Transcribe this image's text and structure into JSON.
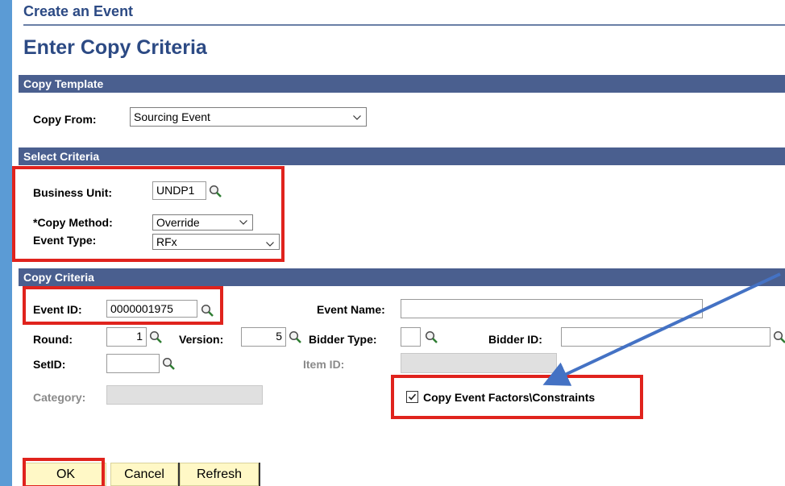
{
  "header": {
    "breadcrumb": "Create an Event",
    "title": "Enter Copy Criteria"
  },
  "copy_template": {
    "section_label": "Copy Template",
    "copy_from_label": "Copy From:",
    "copy_from_value": "Sourcing Event"
  },
  "select_criteria": {
    "section_label": "Select Criteria",
    "business_unit_label": "Business Unit:",
    "business_unit_value": "UNDP1",
    "copy_method_label": "*Copy Method:",
    "copy_method_value": "Override",
    "event_type_label": "Event Type:",
    "event_type_value": "RFx"
  },
  "copy_criteria": {
    "section_label": "Copy Criteria",
    "event_id_label": "Event ID:",
    "event_id_value": "0000001975",
    "event_name_label": "Event Name:",
    "event_name_value": "",
    "round_label": "Round:",
    "round_value": "1",
    "version_label": "Version:",
    "version_value": "5",
    "bidder_type_label": "Bidder Type:",
    "bidder_type_value": "",
    "bidder_id_label": "Bidder ID:",
    "bidder_id_value": "",
    "setid_label": "SetID:",
    "setid_value": "",
    "item_id_label": "Item ID:",
    "item_id_value": "",
    "category_label": "Category:",
    "category_value": "",
    "copy_factors_label": "Copy Event Factors\\Constraints",
    "copy_factors_checked": true
  },
  "buttons": {
    "ok": "OK",
    "cancel": "Cancel",
    "refresh": "Refresh"
  },
  "colors": {
    "highlight": "#e0231d",
    "arrow": "#4472c4",
    "section_bar": "#4a5f8f",
    "title": "#2c4a84"
  }
}
